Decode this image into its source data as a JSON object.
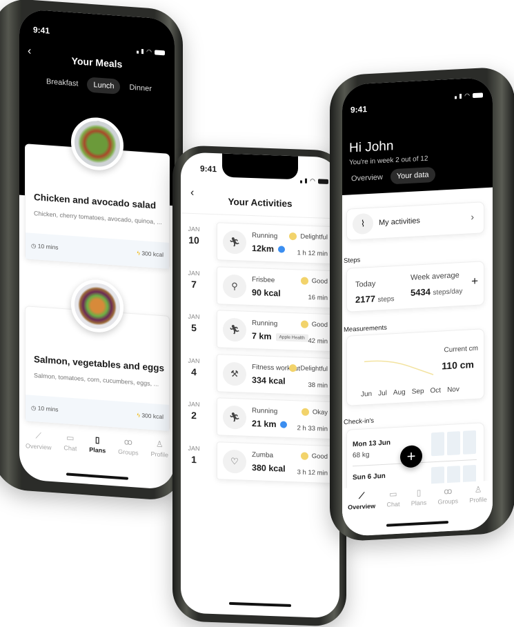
{
  "status": {
    "time": "9:41"
  },
  "meals": {
    "title": "Your Meals",
    "tabs": [
      {
        "label": "Breakfast",
        "active": false
      },
      {
        "label": "Lunch",
        "active": true
      },
      {
        "label": "Dinner",
        "active": false
      }
    ],
    "items": [
      {
        "name": "Chicken and avocado salad",
        "ingredients": "Chicken, cherry tomatoes, avocado, quinoa, ...",
        "time": "10 mins",
        "kcal": "300 kcal"
      },
      {
        "name": "Salmon, vegetables and eggs",
        "ingredients": "Salmon, tomatoes, corn, cucumbers, eggs, ...",
        "time": "10 mins",
        "kcal": "300 kcal"
      }
    ],
    "nav": [
      {
        "label": "Overview"
      },
      {
        "label": "Chat"
      },
      {
        "label": "Plans",
        "active": true
      },
      {
        "label": "Groups"
      },
      {
        "label": "Profile"
      }
    ]
  },
  "activities": {
    "title": "Your Activities",
    "items": [
      {
        "month": "JAN",
        "day": "10",
        "name": "Running",
        "value": "12km",
        "mood": "Delightful",
        "duration": "1 h 12 min",
        "icon": "running-icon",
        "badge": "location-icon"
      },
      {
        "month": "JAN",
        "day": "7",
        "name": "Frisbee",
        "value": "90 kcal",
        "mood": "Good",
        "duration": "16 min",
        "icon": "frisbee-icon"
      },
      {
        "month": "JAN",
        "day": "5",
        "name": "Running",
        "value": "7 km",
        "mood": "Good",
        "duration": "42 min",
        "icon": "running-icon",
        "tag": "Apple Health"
      },
      {
        "month": "JAN",
        "day": "4",
        "name": "Fitness workout",
        "value": "334 kcal",
        "mood": "Delightful",
        "duration": "38 min",
        "icon": "dumbbell-icon"
      },
      {
        "month": "JAN",
        "day": "2",
        "name": "Running",
        "value": "21 km",
        "mood": "Okay",
        "duration": "2 h 33 min",
        "icon": "running-icon",
        "badge": "location-icon"
      },
      {
        "month": "JAN",
        "day": "1",
        "name": "Zumba",
        "value": "380 kcal",
        "mood": "Good",
        "duration": "3 h 12 min",
        "icon": "heart-pulse-icon"
      }
    ]
  },
  "overview": {
    "greeting": "Hi John",
    "subtitle": "You're in week 2 out of 12",
    "tabs": [
      {
        "label": "Overview",
        "active": false
      },
      {
        "label": "Your data",
        "active": true
      }
    ],
    "my_activities": "My activities",
    "steps": {
      "label": "Steps",
      "today_label": "Today",
      "today_value": "2177",
      "today_unit": "steps",
      "avg_label": "Week average",
      "avg_value": "5434",
      "avg_unit": "steps/day"
    },
    "measurements": {
      "label": "Measurements",
      "current_label": "Current cm",
      "current_value": "110 cm",
      "months": [
        "Jun",
        "Jul",
        "Aug",
        "Sep",
        "Oct",
        "Nov"
      ],
      "line_color": "#f3e3a0"
    },
    "checkins": {
      "label": "Check-in's",
      "items": [
        {
          "date": "Mon 13 Jun",
          "value": "68 kg"
        },
        {
          "date": "Sun 6 Jun"
        }
      ]
    },
    "nav": [
      {
        "label": "Overview",
        "active": true
      },
      {
        "label": "Chat"
      },
      {
        "label": "Plans"
      },
      {
        "label": "Groups"
      },
      {
        "label": "Profile"
      }
    ]
  }
}
